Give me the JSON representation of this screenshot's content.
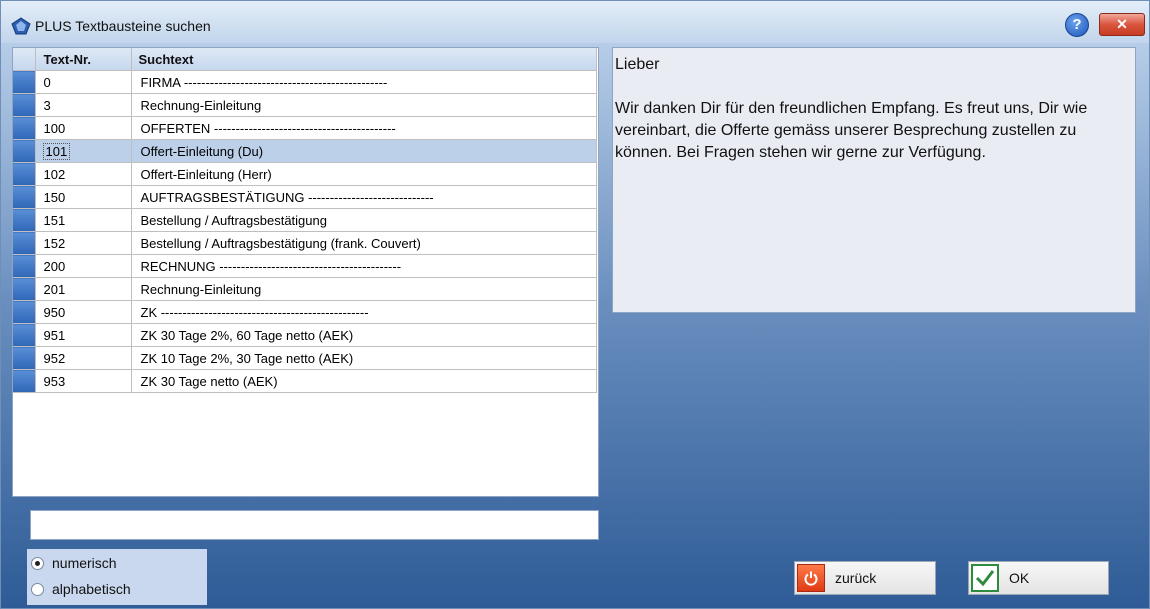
{
  "window": {
    "title": "PLUS Textbausteine suchen",
    "help_label": "?",
    "close_label": "✕"
  },
  "table": {
    "columns": [
      "Text-Nr.",
      "Suchtext"
    ],
    "rows": [
      {
        "nr": "0",
        "text": "FIRMA -----------------------------------------------"
      },
      {
        "nr": "3",
        "text": "Rechnung-Einleitung"
      },
      {
        "nr": "100",
        "text": "OFFERTEN ------------------------------------------"
      },
      {
        "nr": "101",
        "text": "Offert-Einleitung (Du)"
      },
      {
        "nr": "102",
        "text": "Offert-Einleitung (Herr)"
      },
      {
        "nr": "150",
        "text": "AUFTRAGSBESTÄTIGUNG -----------------------------"
      },
      {
        "nr": "151",
        "text": "Bestellung / Auftragsbestätigung"
      },
      {
        "nr": "152",
        "text": "Bestellung / Auftragsbestätigung (frank. Couvert)"
      },
      {
        "nr": "200",
        "text": "RECHNUNG ------------------------------------------"
      },
      {
        "nr": "201",
        "text": "Rechnung-Einleitung"
      },
      {
        "nr": "950",
        "text": "ZK ------------------------------------------------"
      },
      {
        "nr": "951",
        "text": "ZK 30 Tage 2%, 60 Tage  netto (AEK)"
      },
      {
        "nr": "952",
        "text": "ZK 10 Tage 2%, 30 Tage  netto (AEK)"
      },
      {
        "nr": "953",
        "text": "ZK 30 Tage netto (AEK)"
      }
    ],
    "selected_index": 3
  },
  "preview": {
    "greeting": "Lieber",
    "body": "Wir danken Dir für den freundlichen Empfang. Es freut uns, Dir wie vereinbart, die Offerte gemäss unserer Besprechung zustellen zu können. Bei Fragen stehen wir gerne zur Verfügung."
  },
  "search": {
    "value": ""
  },
  "sort": {
    "options": [
      "numerisch",
      "alphabetisch"
    ],
    "selected": "numerisch"
  },
  "buttons": {
    "back_label": "zurück",
    "ok_label": "OK"
  },
  "icons": {
    "title": "plus-gem-icon",
    "help": "help-icon",
    "close": "close-icon",
    "back": "power-icon",
    "ok": "checkmark-icon"
  }
}
